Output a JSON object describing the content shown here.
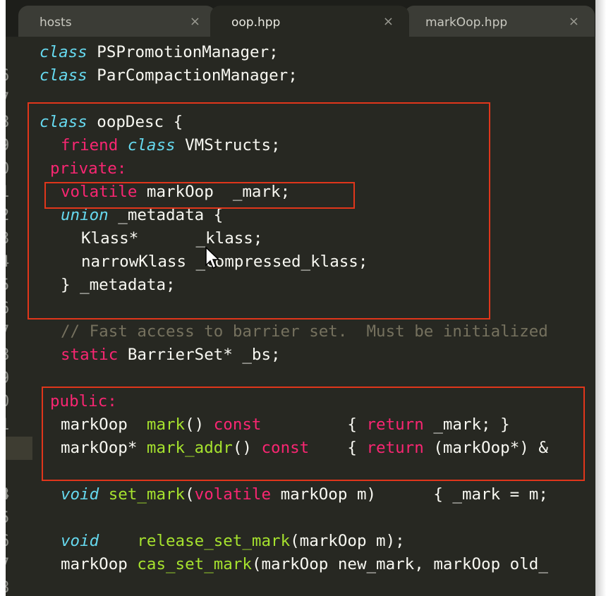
{
  "tabs": [
    {
      "label": "hosts",
      "close": "×",
      "active": false
    },
    {
      "label": "oop.hpp",
      "close": "×",
      "active": true
    },
    {
      "label": "markOop.hpp",
      "close": "×",
      "active": false
    }
  ],
  "lines": [
    {
      "n": "6"
    },
    {
      "n": "7"
    },
    {
      "n": "8"
    },
    {
      "n": "9"
    },
    {
      "n": "0"
    },
    {
      "n": "1"
    },
    {
      "n": "2"
    },
    {
      "n": "3"
    },
    {
      "n": "4"
    },
    {
      "n": "5"
    },
    {
      "n": "6"
    },
    {
      "n": "7"
    },
    {
      "n": "8"
    },
    {
      "n": "9"
    },
    {
      "n": "0"
    },
    {
      "n": "1"
    },
    {
      "n": "2"
    },
    {
      "n": "3"
    },
    {
      "n": "4"
    },
    {
      "n": "5"
    },
    {
      "n": "6"
    },
    {
      "n": "7"
    },
    {
      "n": "8"
    },
    {
      "n": "9"
    }
  ],
  "code": {
    "l6": {
      "kw": "class",
      "rest": " PSPromotionManager;"
    },
    "l7": {
      "kw": "class",
      "rest": " ParCompactionManager;"
    },
    "l9": {
      "kw": "class",
      "rest": " oopDesc {"
    },
    "l10": {
      "kw1": "friend",
      "kw2": "class",
      "rest": " VMStructs;"
    },
    "l11": {
      "label": "private:"
    },
    "l12": {
      "kw": "volatile",
      "rest": " markOop  _mark;"
    },
    "l13": {
      "kw": "union",
      "rest": " _metadata {"
    },
    "l14": {
      "text": "Klass*      _klass;"
    },
    "l15": {
      "text": "narrowKlass _compressed_klass;"
    },
    "l16": {
      "text": "} _metadata;"
    },
    "l18": {
      "comment": "// Fast access to barrier set.  Must be initialized"
    },
    "l19": {
      "kw": "static",
      "rest": " BarrierSet* _bs;"
    },
    "l21": {
      "label": "public:"
    },
    "l22": {
      "type": "markOop  ",
      "fn": "mark",
      "pre": "() ",
      "kw": "const",
      "mid": "         { ",
      "kw2": "return",
      "rest": " _mark; }"
    },
    "l23": {
      "type": "markOop* ",
      "fn": "mark_addr",
      "pre": "() ",
      "kw": "const",
      "mid": "    { ",
      "kw2": "return",
      "rest": " (markOop*) &"
    },
    "l25": {
      "kw": "void",
      "sp": " ",
      "fn": "set_mark",
      "pre": "(",
      "kw2": "volatile",
      "rest": " markOop m)      { _mark = m;"
    },
    "l27": {
      "kw": "void",
      "sp": "    ",
      "fn": "release_set_mark",
      "rest": "(markOop m);"
    },
    "l28": {
      "type": "markOop ",
      "fn": "cas_set_mark",
      "rest": "(markOop new_mark, markOop old_"
    }
  }
}
